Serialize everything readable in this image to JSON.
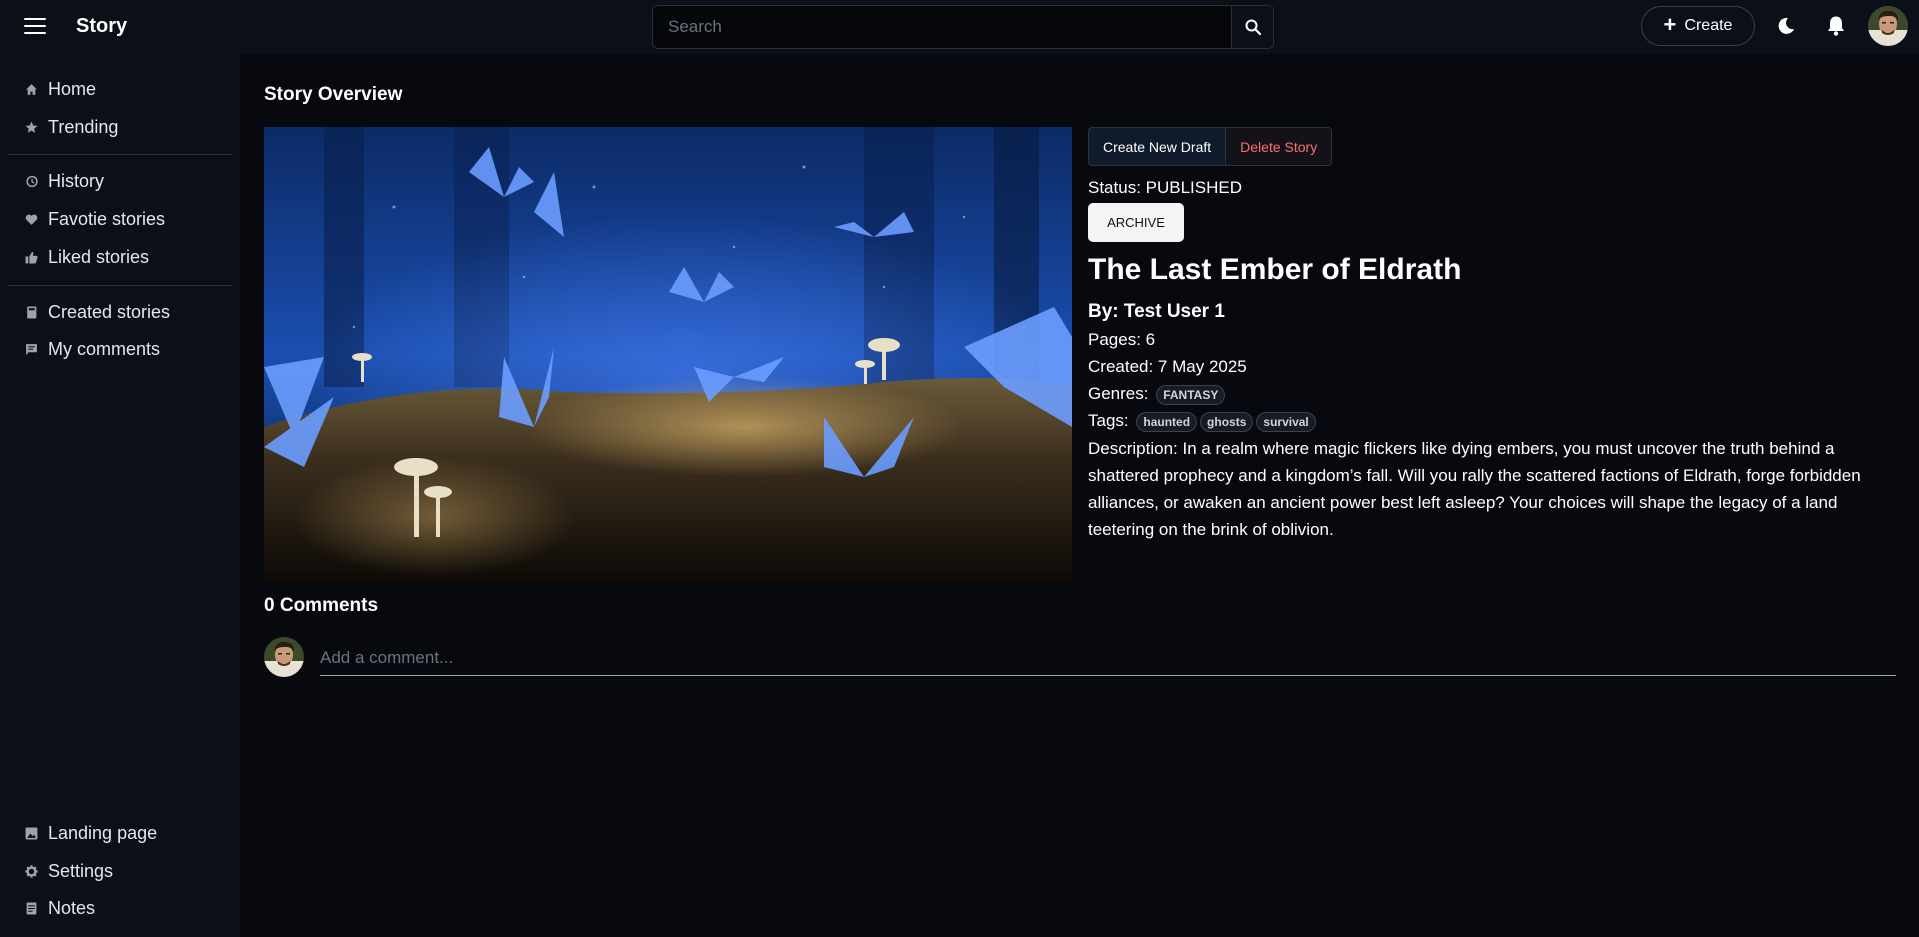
{
  "app": {
    "name": "Story"
  },
  "search": {
    "placeholder": "Search"
  },
  "header": {
    "create_label": "Create"
  },
  "sidebar": {
    "items": [
      {
        "label": "Home",
        "icon": "home-icon"
      },
      {
        "label": "Trending",
        "icon": "star-icon"
      },
      {
        "label": "History",
        "icon": "history-icon"
      },
      {
        "label": "Favotie stories",
        "icon": "heart-icon"
      },
      {
        "label": "Liked stories",
        "icon": "thumbs-up-icon"
      },
      {
        "label": "Created stories",
        "icon": "book-icon"
      },
      {
        "label": "My comments",
        "icon": "comment-icon"
      },
      {
        "label": "Landing page",
        "icon": "image-icon"
      },
      {
        "label": "Settings",
        "icon": "gear-icon"
      },
      {
        "label": "Notes",
        "icon": "notes-icon"
      }
    ]
  },
  "page": {
    "title": "Story Overview"
  },
  "story": {
    "actions": {
      "create_draft": "Create New Draft",
      "delete": "Delete Story"
    },
    "status": "Status: PUBLISHED",
    "archive_label": "ARCHIVE",
    "title": "The Last Ember of Eldrath",
    "author": "By: Test User 1",
    "pages": "Pages: 6",
    "created": "Created: 7 May 2025",
    "genres_label": "Genres:",
    "genres": [
      "FANTASY"
    ],
    "tags_label": "Tags:",
    "tags": [
      "haunted",
      "ghosts",
      "survival"
    ],
    "description": "Description: In a realm where magic flickers like dying embers, you must uncover the truth behind a shattered prophecy and a kingdom’s fall. Will you rally the scattered factions of Eldrath, forge forbidden alliances, or awaken an ancient power best left asleep? Your choices will shape the legacy of a land teetering on the brink of oblivion."
  },
  "comments": {
    "heading": "0 Comments",
    "placeholder": "Add a comment..."
  },
  "colors": {
    "background": "#07090e",
    "surface": "#0b0f18",
    "danger": "#f87171",
    "butterfly": "#6b9dff"
  }
}
